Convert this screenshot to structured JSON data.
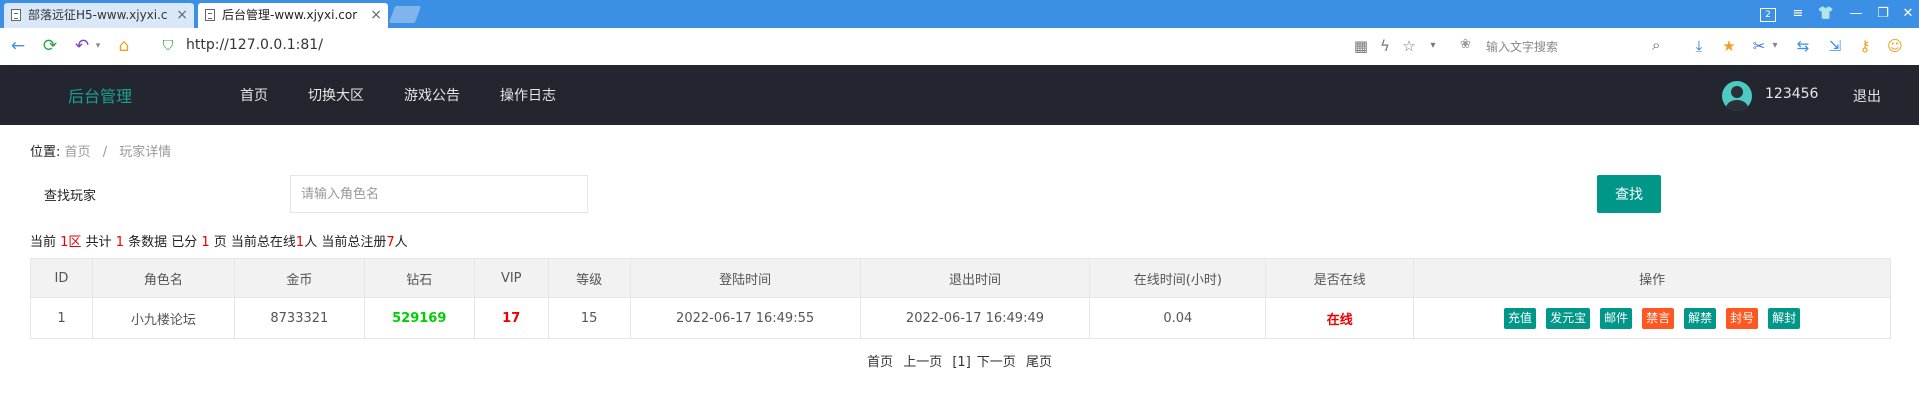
{
  "browser": {
    "tabs": [
      {
        "title": "部落远征H5-www.xjyxi.c"
      },
      {
        "title": "后台管理-www.xjyxi.cor"
      }
    ],
    "tab_count_badge": "2",
    "url": "http://127.0.0.1:81/",
    "search_placeholder": "输入文字搜索"
  },
  "header": {
    "brand": "后台管理",
    "nav": [
      {
        "label": "首页"
      },
      {
        "label": "切换大区"
      },
      {
        "label": "游戏公告"
      },
      {
        "label": "操作日志"
      }
    ],
    "username": "123456",
    "logout": "退出"
  },
  "breadcrumb": {
    "prefix": "位置:",
    "home": "首页",
    "sep": "/",
    "current": "玩家详情"
  },
  "search": {
    "label": "查找玩家",
    "placeholder": "请输入角色名",
    "button": "查找"
  },
  "stats": {
    "t1": "当前 ",
    "region": "1区",
    "t2": " 共计 ",
    "count": "1",
    "t3": " 条数据 已分 ",
    "pages": "1",
    "t4": " 页 当前总在线",
    "online": "1",
    "t5": "人 当前总注册",
    "registered": "7",
    "t6": "人"
  },
  "table": {
    "columns": [
      "ID",
      "角色名",
      "金币",
      "钻石",
      "VIP",
      "等级",
      "登陆时间",
      "退出时间",
      "在线时间(小时)",
      "是否在线",
      "操作"
    ],
    "row": {
      "id": "1",
      "name": "小九楼论坛",
      "gold": "8733321",
      "diamond": "529169",
      "vip": "17",
      "level": "15",
      "login_time": "2022-06-17 16:49:55",
      "logout_time": "2022-06-17 16:49:49",
      "online_hours": "0.04",
      "status": "在线"
    },
    "actions": [
      {
        "label": "充值",
        "color": "#009688"
      },
      {
        "label": "发元宝",
        "color": "#009688"
      },
      {
        "label": "邮件",
        "color": "#009688"
      },
      {
        "label": "禁言",
        "color": "#ff5722"
      },
      {
        "label": "解禁",
        "color": "#009688"
      },
      {
        "label": "封号",
        "color": "#ff5722"
      },
      {
        "label": "解封",
        "color": "#009688"
      }
    ]
  },
  "pager": {
    "first": "首页",
    "prev": "上一页",
    "current": "[1]",
    "next": "下一页",
    "last": "尾页"
  },
  "colors": {
    "accent": "#009688",
    "danger": "#ff5722",
    "header_bg": "#23262e",
    "tabbar_bg": "#3b8fe5"
  }
}
